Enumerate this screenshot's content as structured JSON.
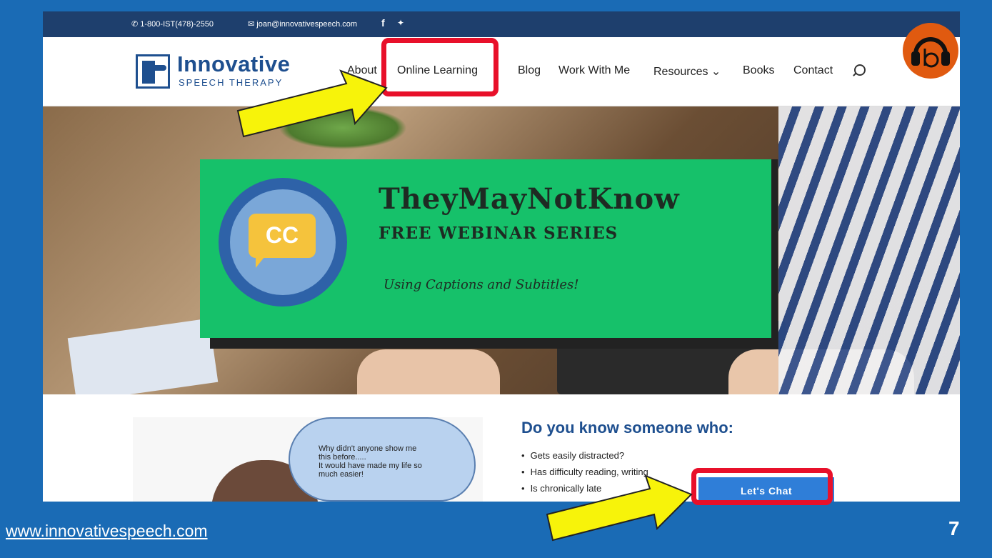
{
  "topbar": {
    "phone": "1-800-IST(478)-2550",
    "email": "joan@innovativespeech.com"
  },
  "logo": {
    "name": "Innovative",
    "sub": "SPEECH THERAPY"
  },
  "nav": [
    "About",
    "Online Learning",
    "Blog",
    "Work With Me",
    "Resources ⌄",
    "Books",
    "Contact"
  ],
  "banner": {
    "cc": "CC",
    "title": "TheyMayNotKnow",
    "subtitle": "FREE WEBINAR SERIES",
    "tagline": "Using Captions and Subtitles!"
  },
  "cloud": {
    "line1": "Why didn't anyone show me",
    "line2": "this before.....",
    "line3": "It would have made my life so",
    "line4": "much easier!"
  },
  "content": {
    "title": "Do you know someone who:",
    "bullets": [
      "Gets easily distracted?",
      "Has difficulty reading, writing",
      "Is chronically late"
    ]
  },
  "chat_button": "Let's Chat",
  "footer": {
    "url": "www.innovativespeech.com",
    "slide_number": "7"
  },
  "colors": {
    "slide_bg": "#1a6bb5",
    "topbar": "#1e3f6d",
    "banner": "#16c16a",
    "highlight": "#e8102a",
    "arrow": "#f7f30a",
    "chat": "#2f7ed8"
  }
}
